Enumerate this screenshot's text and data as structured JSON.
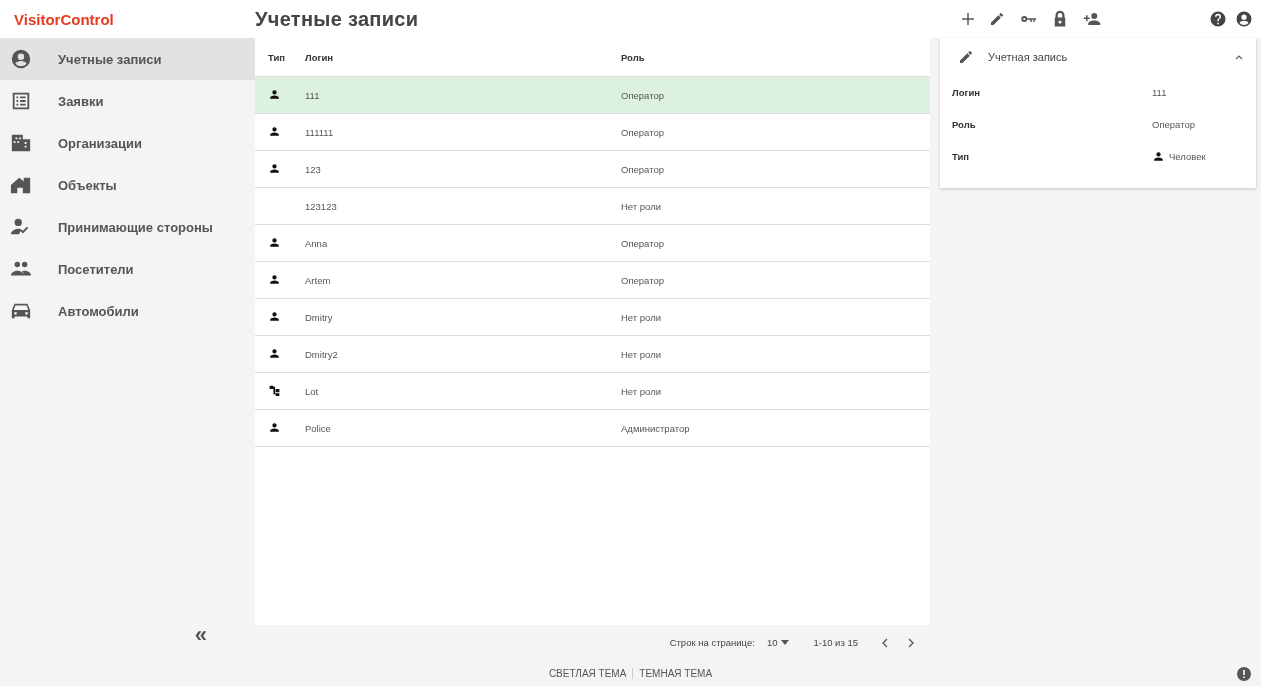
{
  "app": {
    "logo": "VisitorControl",
    "title": "Учетные записи"
  },
  "sidebar": {
    "items": [
      {
        "label": "Учетные записи",
        "selected": true
      },
      {
        "label": "Заявки",
        "selected": false
      },
      {
        "label": "Организации",
        "selected": false
      },
      {
        "label": "Объекты",
        "selected": false
      },
      {
        "label": "Принимающие стороны",
        "selected": false
      },
      {
        "label": "Посетители",
        "selected": false
      },
      {
        "label": "Автомобили",
        "selected": false
      }
    ],
    "collapse": "«"
  },
  "table": {
    "columns": [
      "Тип",
      "Логин",
      "Роль"
    ],
    "rows": [
      {
        "kind": "person",
        "login": "111",
        "role": "Оператор",
        "selected": true
      },
      {
        "kind": "person",
        "login": "111111",
        "role": "Оператор",
        "selected": false
      },
      {
        "kind": "person",
        "login": "123",
        "role": "Оператор",
        "selected": false
      },
      {
        "kind": "none",
        "login": "123123",
        "role": "Нет роли",
        "selected": false
      },
      {
        "kind": "person",
        "login": "Anna",
        "role": "Оператор",
        "selected": false
      },
      {
        "kind": "person",
        "login": "Artem",
        "role": "Оператор",
        "selected": false
      },
      {
        "kind": "person",
        "login": "Dmitry",
        "role": "Нет роли",
        "selected": false
      },
      {
        "kind": "person",
        "login": "Dmitry2",
        "role": "Нет роли",
        "selected": false
      },
      {
        "kind": "device",
        "login": "Lot",
        "role": "Нет роли",
        "selected": false
      },
      {
        "kind": "person",
        "login": "Police",
        "role": "Администратор",
        "selected": false
      }
    ]
  },
  "pagination": {
    "rows_label": "Строк на странице:",
    "rows_value": "10",
    "range": "1-10 из 15"
  },
  "details": {
    "title": "Учетная запись",
    "expanded": true,
    "fields": [
      {
        "label": "Логин",
        "value": "111"
      },
      {
        "label": "Роль",
        "value": "Оператор"
      },
      {
        "label": "Тип",
        "value": "Человек",
        "kind": "person"
      }
    ]
  },
  "footer": {
    "themes": [
      "СВЕТЛАЯ ТЕМА",
      "ТЕМНАЯ ТЕМА"
    ]
  }
}
